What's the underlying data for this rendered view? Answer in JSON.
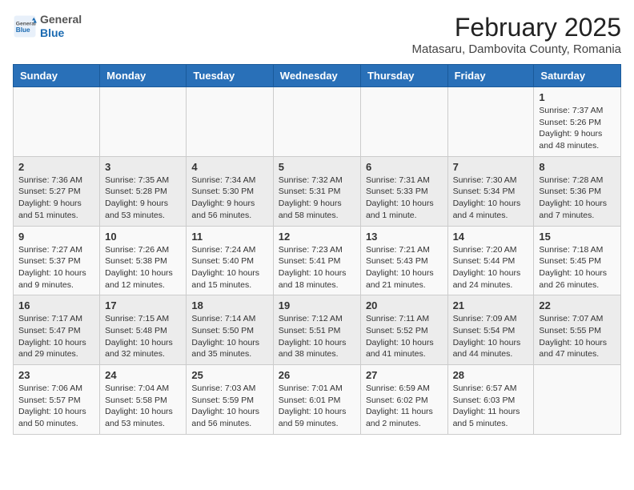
{
  "header": {
    "logo": {
      "general": "General",
      "blue": "Blue"
    },
    "title": "February 2025",
    "subtitle": "Matasaru, Dambovita County, Romania"
  },
  "weekdays": [
    "Sunday",
    "Monday",
    "Tuesday",
    "Wednesday",
    "Thursday",
    "Friday",
    "Saturday"
  ],
  "weeks": [
    [
      {
        "day": "",
        "info": ""
      },
      {
        "day": "",
        "info": ""
      },
      {
        "day": "",
        "info": ""
      },
      {
        "day": "",
        "info": ""
      },
      {
        "day": "",
        "info": ""
      },
      {
        "day": "",
        "info": ""
      },
      {
        "day": "1",
        "info": "Sunrise: 7:37 AM\nSunset: 5:26 PM\nDaylight: 9 hours and 48 minutes."
      }
    ],
    [
      {
        "day": "2",
        "info": "Sunrise: 7:36 AM\nSunset: 5:27 PM\nDaylight: 9 hours and 51 minutes."
      },
      {
        "day": "3",
        "info": "Sunrise: 7:35 AM\nSunset: 5:28 PM\nDaylight: 9 hours and 53 minutes."
      },
      {
        "day": "4",
        "info": "Sunrise: 7:34 AM\nSunset: 5:30 PM\nDaylight: 9 hours and 56 minutes."
      },
      {
        "day": "5",
        "info": "Sunrise: 7:32 AM\nSunset: 5:31 PM\nDaylight: 9 hours and 58 minutes."
      },
      {
        "day": "6",
        "info": "Sunrise: 7:31 AM\nSunset: 5:33 PM\nDaylight: 10 hours and 1 minute."
      },
      {
        "day": "7",
        "info": "Sunrise: 7:30 AM\nSunset: 5:34 PM\nDaylight: 10 hours and 4 minutes."
      },
      {
        "day": "8",
        "info": "Sunrise: 7:28 AM\nSunset: 5:36 PM\nDaylight: 10 hours and 7 minutes."
      }
    ],
    [
      {
        "day": "9",
        "info": "Sunrise: 7:27 AM\nSunset: 5:37 PM\nDaylight: 10 hours and 9 minutes."
      },
      {
        "day": "10",
        "info": "Sunrise: 7:26 AM\nSunset: 5:38 PM\nDaylight: 10 hours and 12 minutes."
      },
      {
        "day": "11",
        "info": "Sunrise: 7:24 AM\nSunset: 5:40 PM\nDaylight: 10 hours and 15 minutes."
      },
      {
        "day": "12",
        "info": "Sunrise: 7:23 AM\nSunset: 5:41 PM\nDaylight: 10 hours and 18 minutes."
      },
      {
        "day": "13",
        "info": "Sunrise: 7:21 AM\nSunset: 5:43 PM\nDaylight: 10 hours and 21 minutes."
      },
      {
        "day": "14",
        "info": "Sunrise: 7:20 AM\nSunset: 5:44 PM\nDaylight: 10 hours and 24 minutes."
      },
      {
        "day": "15",
        "info": "Sunrise: 7:18 AM\nSunset: 5:45 PM\nDaylight: 10 hours and 26 minutes."
      }
    ],
    [
      {
        "day": "16",
        "info": "Sunrise: 7:17 AM\nSunset: 5:47 PM\nDaylight: 10 hours and 29 minutes."
      },
      {
        "day": "17",
        "info": "Sunrise: 7:15 AM\nSunset: 5:48 PM\nDaylight: 10 hours and 32 minutes."
      },
      {
        "day": "18",
        "info": "Sunrise: 7:14 AM\nSunset: 5:50 PM\nDaylight: 10 hours and 35 minutes."
      },
      {
        "day": "19",
        "info": "Sunrise: 7:12 AM\nSunset: 5:51 PM\nDaylight: 10 hours and 38 minutes."
      },
      {
        "day": "20",
        "info": "Sunrise: 7:11 AM\nSunset: 5:52 PM\nDaylight: 10 hours and 41 minutes."
      },
      {
        "day": "21",
        "info": "Sunrise: 7:09 AM\nSunset: 5:54 PM\nDaylight: 10 hours and 44 minutes."
      },
      {
        "day": "22",
        "info": "Sunrise: 7:07 AM\nSunset: 5:55 PM\nDaylight: 10 hours and 47 minutes."
      }
    ],
    [
      {
        "day": "23",
        "info": "Sunrise: 7:06 AM\nSunset: 5:57 PM\nDaylight: 10 hours and 50 minutes."
      },
      {
        "day": "24",
        "info": "Sunrise: 7:04 AM\nSunset: 5:58 PM\nDaylight: 10 hours and 53 minutes."
      },
      {
        "day": "25",
        "info": "Sunrise: 7:03 AM\nSunset: 5:59 PM\nDaylight: 10 hours and 56 minutes."
      },
      {
        "day": "26",
        "info": "Sunrise: 7:01 AM\nSunset: 6:01 PM\nDaylight: 10 hours and 59 minutes."
      },
      {
        "day": "27",
        "info": "Sunrise: 6:59 AM\nSunset: 6:02 PM\nDaylight: 11 hours and 2 minutes."
      },
      {
        "day": "28",
        "info": "Sunrise: 6:57 AM\nSunset: 6:03 PM\nDaylight: 11 hours and 5 minutes."
      },
      {
        "day": "",
        "info": ""
      }
    ]
  ]
}
